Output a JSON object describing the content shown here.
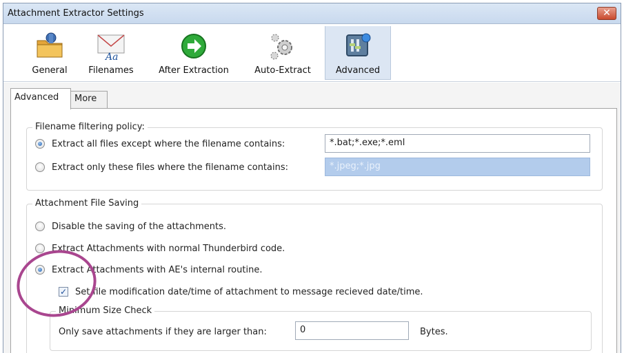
{
  "window": {
    "title": "Attachment Extractor Settings",
    "close_symbol": "✕"
  },
  "toolbar": {
    "items": [
      {
        "label": "General",
        "icon": "general-icon"
      },
      {
        "label": "Filenames",
        "icon": "filenames-icon"
      },
      {
        "label": "After Extraction",
        "icon": "after-extraction-icon"
      },
      {
        "label": "Auto-Extract",
        "icon": "auto-extract-icon"
      },
      {
        "label": "Advanced",
        "icon": "advanced-icon",
        "selected": true
      }
    ]
  },
  "tabs": [
    {
      "label": "Advanced",
      "active": true
    },
    {
      "label": "More",
      "active": false
    }
  ],
  "filtering": {
    "title": "Filename filtering policy:",
    "option1": {
      "label": "Extract all files except where the filename contains:",
      "value": "*.bat;*.exe;*.eml",
      "checked": true
    },
    "option2": {
      "label": "Extract only these files where the filename contains:",
      "value": "*.jpeg;*.jpg",
      "checked": false
    }
  },
  "saving": {
    "title": "Attachment File Saving",
    "options": [
      {
        "label": "Disable the saving of the attachments.",
        "checked": false
      },
      {
        "label": "Extract Attachments with normal Thunderbird code.",
        "checked": false
      },
      {
        "label": "Extract Attachments with AE's internal routine.",
        "checked": true
      }
    ],
    "set_date": {
      "label": "Set file modification date/time of attachment to message recieved date/time.",
      "checked": true
    },
    "min_size": {
      "title": "Minimum Size Check",
      "label": "Only save attachments if they are larger than:",
      "value": "0",
      "unit": "Bytes."
    }
  },
  "colors": {
    "annotation": "#a9468f",
    "selected_tab": "#dce6f3",
    "disabled_field": "#b3ccec"
  }
}
